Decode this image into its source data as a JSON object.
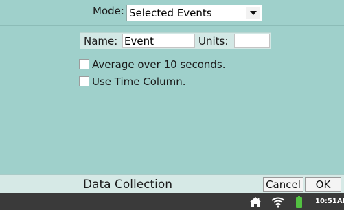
{
  "mode": {
    "label": "Mode:",
    "selected": "Selected Events",
    "icon": "chevron-down-icon"
  },
  "event_fields": {
    "name_label": "Name:",
    "name_value": "Event",
    "units_label": "Units:",
    "units_value": ""
  },
  "options": [
    {
      "label": "Average over 10 seconds.",
      "checked": false
    },
    {
      "label": "Use Time Column.",
      "checked": false
    }
  ],
  "toolbar": {
    "title": "Data Collection",
    "cancel_label": "Cancel",
    "ok_label": "OK"
  },
  "status_bar": {
    "icons": [
      "home-icon",
      "wifi-icon",
      "battery-icon"
    ],
    "time": "10:51AM"
  },
  "colors": {
    "background": "#9fd0cb",
    "toolbar": "#d6e9e6",
    "status_bar": "#3a3a3a",
    "battery": "#52c141"
  }
}
